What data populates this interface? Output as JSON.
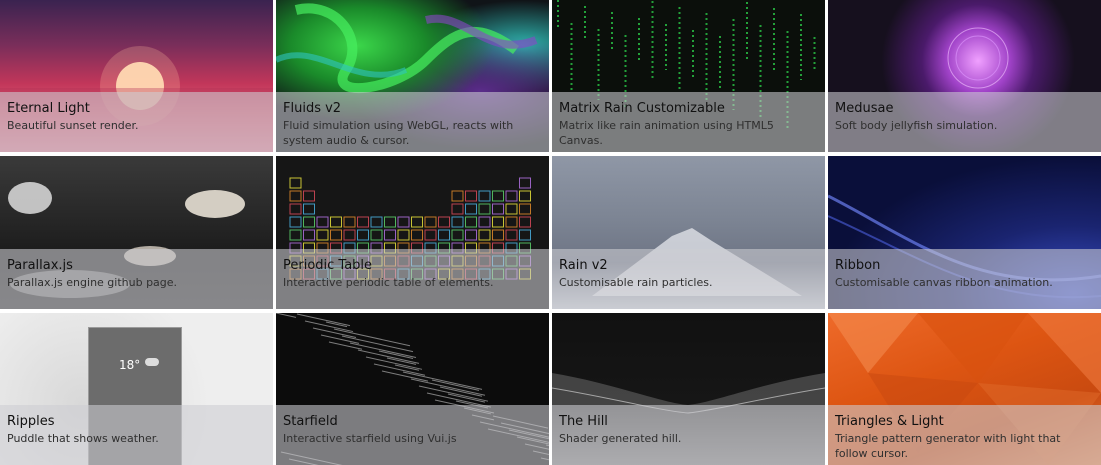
{
  "tiles": [
    {
      "title": "Eternal Light",
      "desc": "Beautiful sunset render."
    },
    {
      "title": "Fluids v2",
      "desc": "Fluid simulation using WebGL, reacts with system audio & cursor."
    },
    {
      "title": "Matrix Rain Customizable",
      "desc": "Matrix like rain animation using HTML5 Canvas."
    },
    {
      "title": "Medusae",
      "desc": "Soft body jellyfish simulation."
    },
    {
      "title": "Parallax.js",
      "desc": "Parallax.js engine github page."
    },
    {
      "title": "Periodic Table",
      "desc": "Interactive periodic table of elements."
    },
    {
      "title": "Rain v2",
      "desc": "Customisable rain particles."
    },
    {
      "title": "Ribbon",
      "desc": "Customisable canvas ribbon animation."
    },
    {
      "title": "Ripples",
      "desc": "Puddle that shows weather."
    },
    {
      "title": "Starfield",
      "desc": "Interactive starfield using Vui.js"
    },
    {
      "title": "The Hill",
      "desc": "Shader generated hill."
    },
    {
      "title": "Triangles & Light",
      "desc": "Triangle pattern generator with light that follow cursor."
    }
  ],
  "weather_card": {
    "temperature": "18°"
  }
}
